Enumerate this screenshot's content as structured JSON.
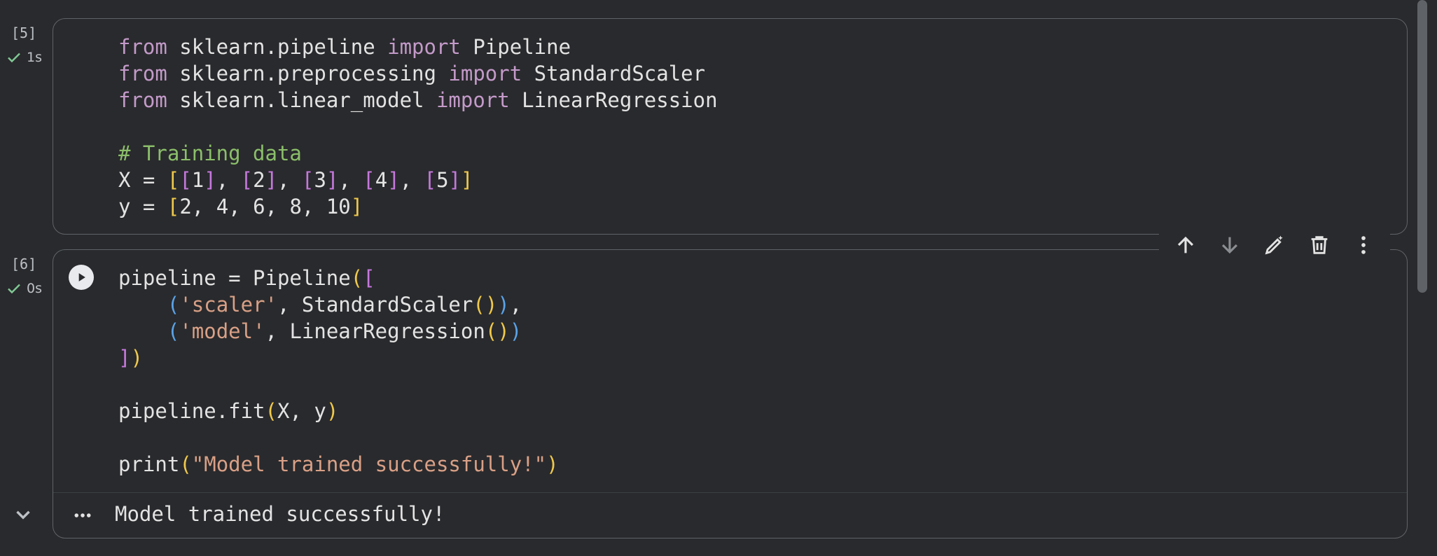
{
  "cells": [
    {
      "exec_count": "[5]",
      "status_time": "1s",
      "code_lines": [
        "from sklearn.pipeline import Pipeline",
        "from sklearn.preprocessing import StandardScaler",
        "from sklearn.linear_model import LinearRegression",
        "",
        "# Training data",
        "X = [[1], [2], [3], [4], [5]]",
        "y = [2, 4, 6, 8, 10]"
      ]
    },
    {
      "exec_count": "[6]",
      "status_time": "0s",
      "code_lines": [
        "pipeline = Pipeline([",
        "    ('scaler', StandardScaler()),",
        "    ('model', LinearRegression())",
        "])",
        "",
        "pipeline.fit(X, y)",
        "",
        "print(\"Model trained successfully!\")"
      ],
      "output": "Model trained successfully!"
    }
  ],
  "toolbar": {
    "icons": [
      "arrow-up-icon",
      "arrow-down-icon",
      "magic-edit-icon",
      "trash-icon",
      "more-vert-icon"
    ]
  },
  "colors": {
    "background": "#292a2d",
    "keyword": "#c39ac9",
    "comment": "#8bbf6a",
    "string": "#d9a086",
    "bracket_1": "#f0c94a",
    "bracket_2": "#c678dd",
    "bracket_3": "#5aa3e8",
    "success": "#81c995"
  }
}
